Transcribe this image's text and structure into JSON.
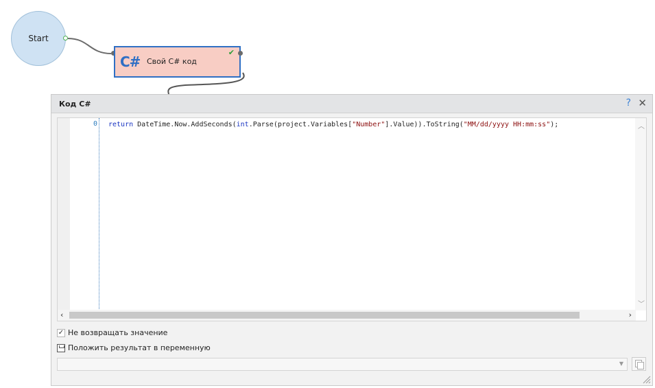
{
  "start_node": {
    "label": "Start"
  },
  "action_node": {
    "logo": "C#",
    "title": "Свой C# код",
    "status_icon": "check-icon"
  },
  "dialog": {
    "title": "Код C#",
    "help_label": "?",
    "close_label": "✕",
    "editor": {
      "line_numbers": [
        "0"
      ],
      "code": {
        "kw1": "return",
        "t1": " DateTime.Now.AddSeconds(",
        "kw2": "int",
        "t2": ".Parse(project.Variables[",
        "s1": "\"Number\"",
        "t3": "].Value)).ToString(",
        "s2": "\"MM/dd/yyyy HH:mm:ss\"",
        "t4": ");"
      }
    },
    "options": {
      "no_return_checked": true,
      "no_return_label": "Не возвращать значение",
      "save_result_label": "Положить результат в переменную"
    },
    "variable_select": {
      "value": ""
    }
  },
  "colors": {
    "node_border": "#2f6fc4",
    "node_fill": "#f8cdc4",
    "start_fill": "#cfe2f3",
    "keyword": "#1a35c2",
    "string": "#8b0d0d"
  }
}
